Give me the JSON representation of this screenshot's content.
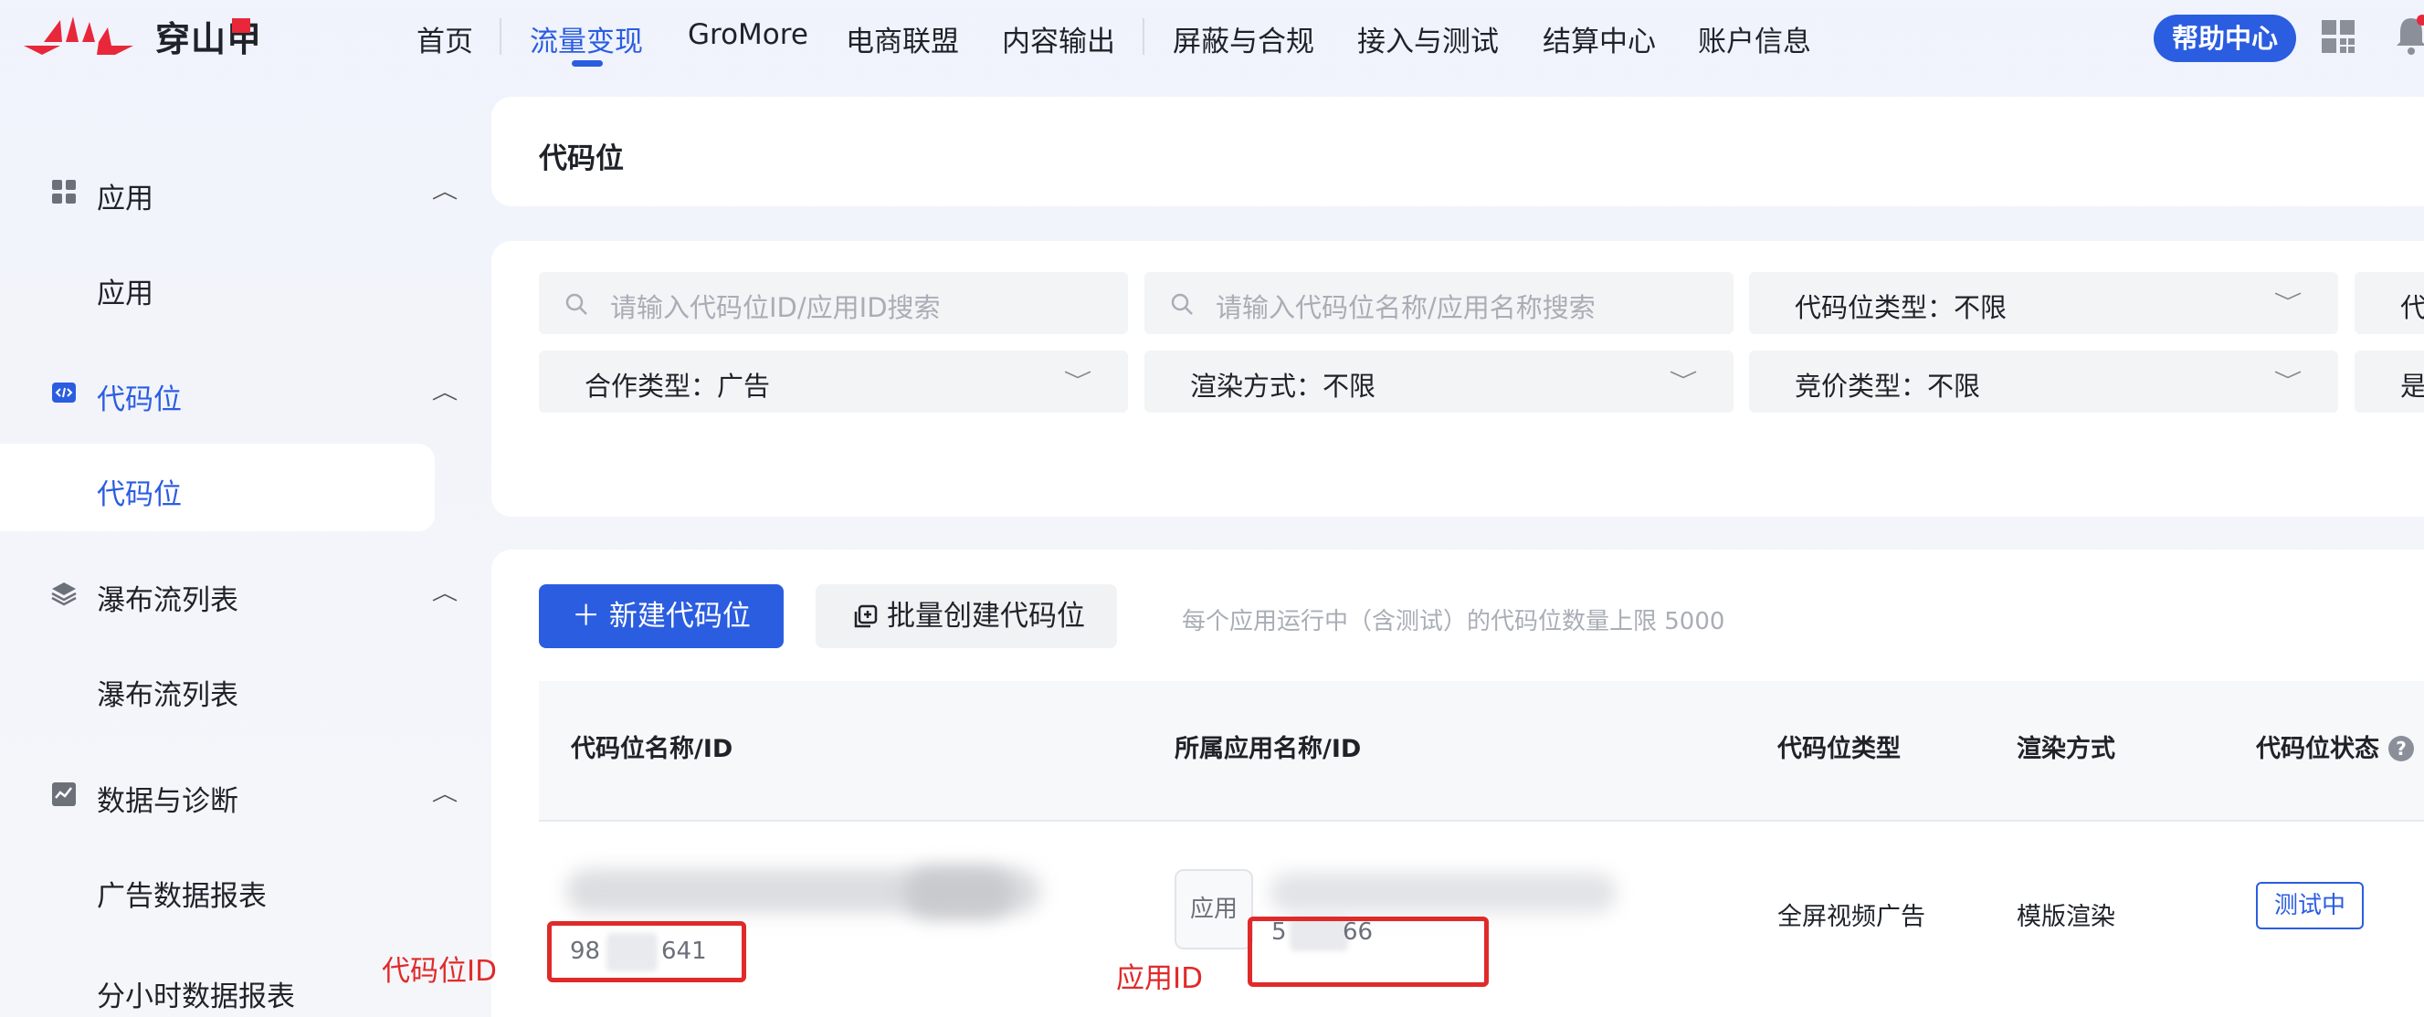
{
  "brand": {
    "name": "穿山甲"
  },
  "nav": {
    "items": [
      {
        "label": "首页"
      },
      {
        "label": "流量变现"
      },
      {
        "label": "GroMore"
      },
      {
        "label": "电商联盟"
      },
      {
        "label": "内容输出"
      },
      {
        "label": "屏蔽与合规"
      },
      {
        "label": "接入与测试"
      },
      {
        "label": "结算中心"
      },
      {
        "label": "账户信息"
      }
    ],
    "active": "流量变现",
    "help_label": "帮助中心"
  },
  "sidebar": {
    "groups": [
      {
        "label": "应用",
        "icon": "grid-icon",
        "sub": [
          "应用"
        ]
      },
      {
        "label": "代码位",
        "icon": "code-icon",
        "sub": [
          "代码位"
        ]
      },
      {
        "label": "瀑布流列表",
        "icon": "layers-icon",
        "sub": [
          "瀑布流列表"
        ]
      },
      {
        "label": "数据与诊断",
        "icon": "chart-icon",
        "sub": [
          "广告数据报表",
          "分小时数据报表"
        ]
      }
    ]
  },
  "page": {
    "title": "代码位"
  },
  "filters": {
    "search_id_placeholder": "请输入代码位ID/应用ID搜索",
    "search_name_placeholder": "请输入代码位名称/应用名称搜索",
    "slot_type": "代码位类型：不限",
    "coop_type": "合作类型：广告",
    "render_mode": "渲染方式：不限",
    "bid_type": "竞价类型：不限",
    "cut_right_1": "代",
    "cut_right_2": "是"
  },
  "actions": {
    "new_label": "新建代码位",
    "batch_label": "批量创建代码位",
    "hint": "每个应用运行中（含测试）的代码位数量上限 5000"
  },
  "table": {
    "columns": [
      "代码位名称/ID",
      "所属应用名称/ID",
      "代码位类型",
      "渲染方式",
      "代码位状态"
    ],
    "rows": [
      {
        "slot_id_prefix": "98",
        "slot_id_suffix": "641",
        "app_chip": "应用",
        "app_id_prefix": "5",
        "app_id_suffix": "66",
        "slot_type": "全屏视频广告",
        "render": "模版渲染",
        "status": "测试中"
      }
    ]
  },
  "annotations": {
    "slot_id_label": "代码位ID",
    "app_id_label": "应用ID"
  },
  "colors": {
    "accent": "#2b5de0",
    "annotation": "#e02a2a"
  }
}
